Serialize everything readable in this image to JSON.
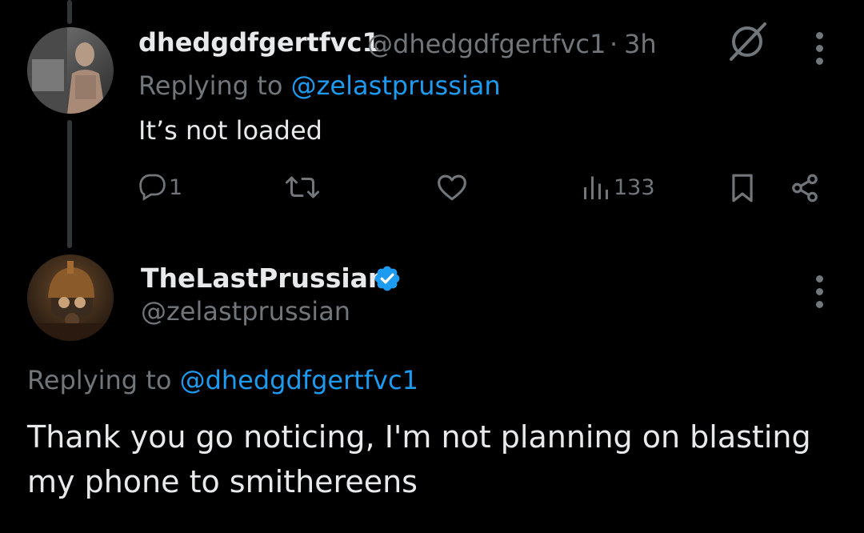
{
  "reply_tweet": {
    "display_name": "dhedgdfgertfvc1",
    "handle": "@dhedgdfgertfvc1",
    "separator": "·",
    "time": "3h",
    "replying_prefix": "Replying to",
    "replying_to": "@zelastprussian",
    "text": "It’s not loaded",
    "actions": {
      "reply_count": "1",
      "repost_count": "",
      "like_count": "",
      "views_count": "133"
    }
  },
  "main_tweet": {
    "display_name": "TheLastPrussian",
    "verified": true,
    "handle": "@zelastprussian",
    "replying_prefix": "Replying to",
    "replying_to": "@dhedgdfgertfvc1",
    "text_line1": "Thank you go noticing, I'm not planning on blasting",
    "text_line2": "my phone to smithereens"
  },
  "colors": {
    "background": "#000000",
    "text": "#e7e9ea",
    "muted": "#71767b",
    "link": "#1d9bf0",
    "verified": "#1d9bf0"
  },
  "icons": [
    "grok-icon",
    "more-icon",
    "reply-icon",
    "repost-icon",
    "like-icon",
    "views-icon",
    "bookmark-icon",
    "share-icon",
    "verified-badge-icon"
  ]
}
